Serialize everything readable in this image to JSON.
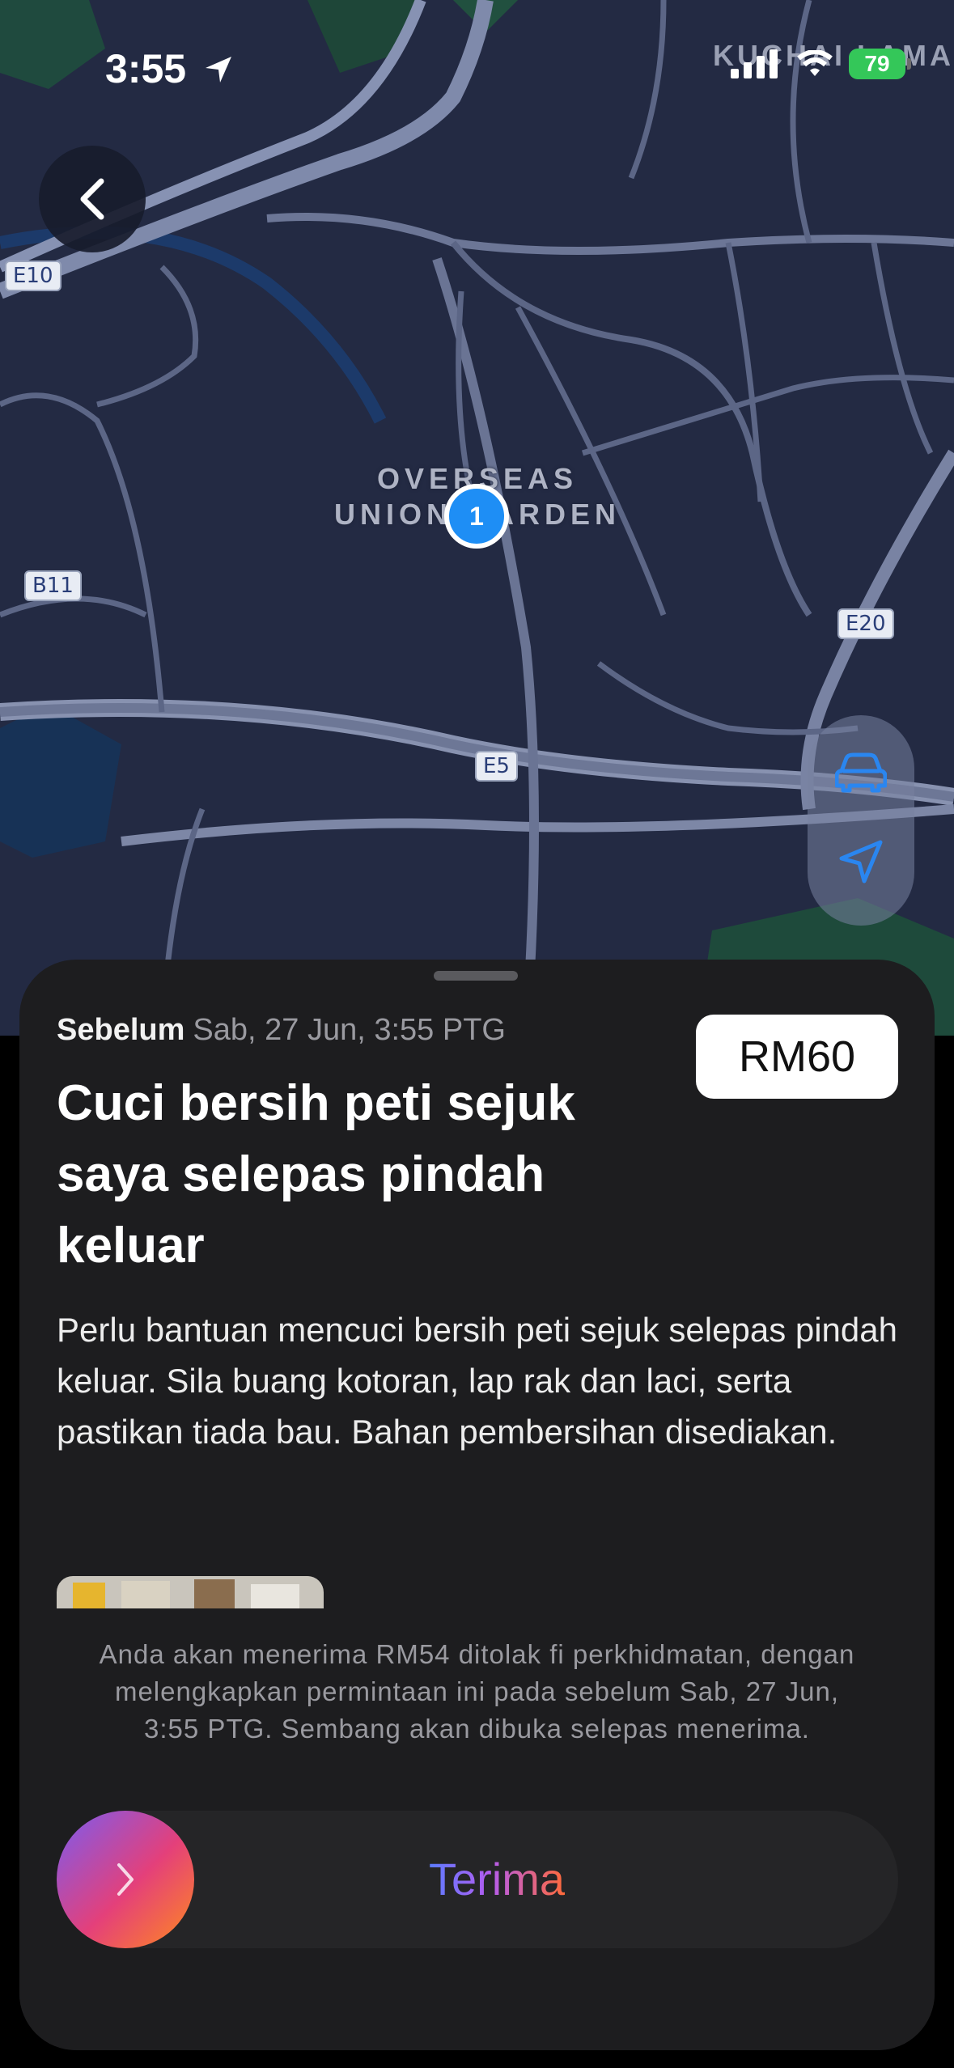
{
  "status_bar": {
    "time": "3:55",
    "battery": "79"
  },
  "map": {
    "area_label_line1": "OVERSEAS",
    "area_label_line2": "UNION GARDEN",
    "edge_label": "KUCHAI LAMA",
    "roads": [
      "E10",
      "B11",
      "E20",
      "E5"
    ],
    "pin_count": "1"
  },
  "task": {
    "deadline_label": "Sebelum",
    "deadline_value": "Sab, 27 Jun, 3:55 PTG",
    "price": "RM60",
    "title": "Cuci bersih peti sejuk saya selepas pindah keluar",
    "description": "Perlu bantuan mencuci bersih peti sejuk selepas pindah keluar. Sila buang kotoran, lap rak dan laci, serta pastikan tiada bau. Bahan pembersihan disediakan."
  },
  "footer": {
    "note": "Anda akan menerima RM54 ditolak fi perkhidmatan, dengan melengkapkan permintaan ini pada sebelum Sab, 27 Jun, 3:55 PTG. Sembang akan dibuka selepas menerima.",
    "accept_label": "Terima"
  },
  "icons": {
    "back": "chevron-left-icon",
    "car": "car-icon",
    "locate": "location-arrow-icon",
    "slider": "chevron-right-icon"
  },
  "colors": {
    "pin": "#1e8ef5",
    "map_bg": "#232a43",
    "battery": "#34c759",
    "sheet_bg": "#1d1d1f"
  }
}
